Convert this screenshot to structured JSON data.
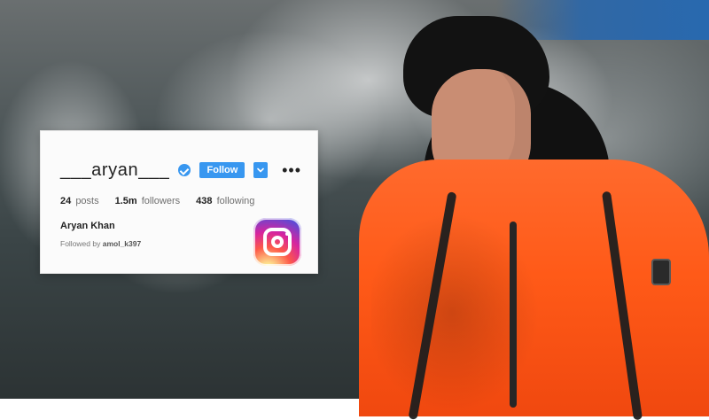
{
  "profile": {
    "username": "___aryan___",
    "follow_label": "Follow",
    "stats": {
      "posts_num": "24",
      "posts_label": "posts",
      "followers_num": "1.5m",
      "followers_label": "followers",
      "following_num": "438",
      "following_label": "following"
    },
    "full_name": "Aryan Khan",
    "followed_by_label": "Followed by",
    "followed_by_account": "amol_k397"
  },
  "icons": {
    "verified": "verified-badge-icon",
    "dropdown": "chevron-down-icon",
    "more": "more-dots-icon",
    "instagram": "instagram-logo-icon"
  },
  "colors": {
    "follow_blue": "#3897f0",
    "jacket_orange": "#ff5a18"
  }
}
